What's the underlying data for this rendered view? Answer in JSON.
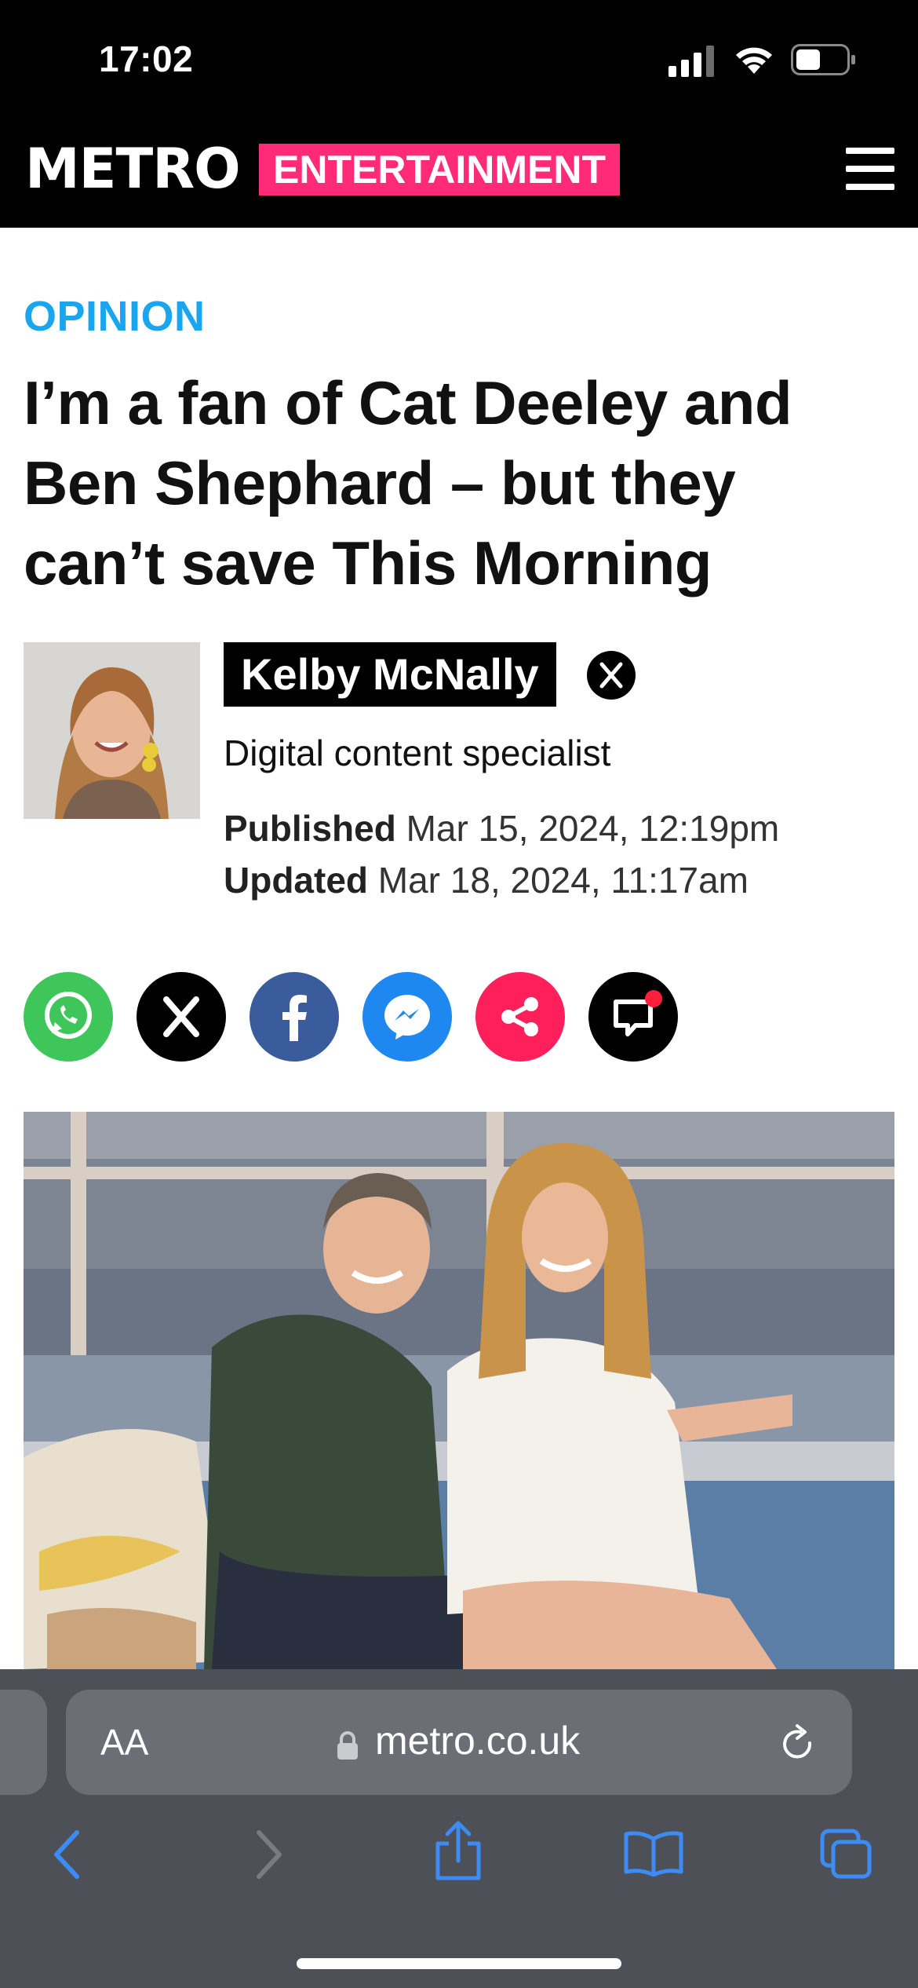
{
  "status_bar": {
    "time": "17:02"
  },
  "header": {
    "logo": "METRO",
    "section": "ENTERTAINMENT",
    "brand_pink": "#ff2a78",
    "menu_icon": "hamburger-menu-icon"
  },
  "article": {
    "kicker": "OPINION",
    "kicker_color": "#1aa6ee",
    "headline": "I’m a fan of Cat Deeley and Ben Shephard – but they can’t save This Morning",
    "author": {
      "name": "Kelby McNally",
      "role": "Digital content specialist",
      "social_icon": "x-logo-icon"
    },
    "published_label": "Published",
    "published_date": "Mar 15, 2024, 12:19pm",
    "updated_label": "Updated",
    "updated_date": "Mar 18, 2024, 11:17am",
    "share_buttons": [
      {
        "icon": "whatsapp-icon",
        "color": "#3ec65a"
      },
      {
        "icon": "x-logo-icon",
        "color": "#000000"
      },
      {
        "icon": "facebook-icon",
        "color": "#3b5c9c"
      },
      {
        "icon": "messenger-icon",
        "color": "#1e88f0"
      },
      {
        "icon": "share-icon",
        "color": "#ff1f5a"
      },
      {
        "icon": "comments-icon",
        "color": "#000000"
      }
    ]
  },
  "browser": {
    "text_size_label": "AA",
    "url": "metro.co.uk",
    "lock_icon": "lock-icon",
    "reload_icon": "reload-icon",
    "toolbar_icons": [
      "back-icon",
      "forward-icon",
      "share-icon",
      "bookmarks-icon",
      "tabs-icon"
    ],
    "accent": "#3d8bf5"
  }
}
